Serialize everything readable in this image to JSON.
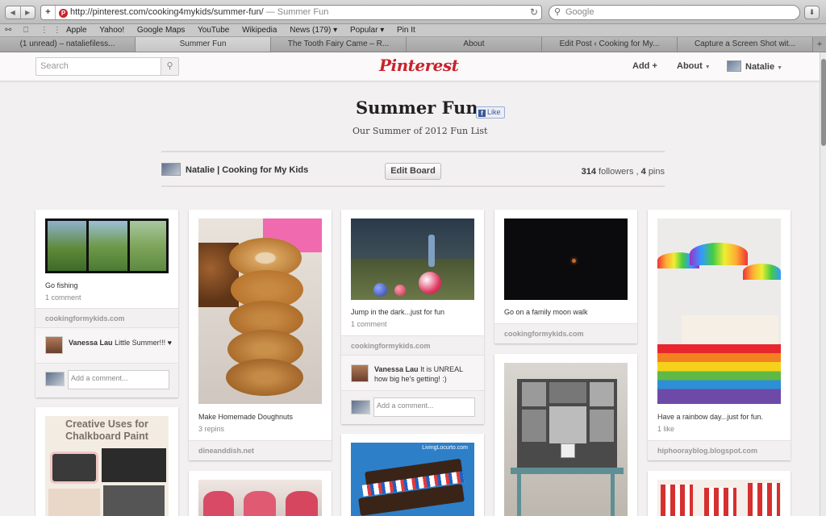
{
  "browser": {
    "url": "http://pinterest.com/cooking4mykids/summer-fun/",
    "page_title": "— Summer Fun",
    "search_placeholder": "Google",
    "bookmarks": [
      "Apple",
      "Yahoo!",
      "Google Maps",
      "YouTube",
      "Wikipedia",
      "News (179) ▾",
      "Popular ▾",
      "Pin It"
    ],
    "tabs": [
      {
        "label": "(1 unread) – nataliefiless...",
        "active": false
      },
      {
        "label": "Summer Fun",
        "active": true
      },
      {
        "label": "The Tooth Fairy Came – R...",
        "active": false
      },
      {
        "label": "About",
        "active": false
      },
      {
        "label": "Edit Post ‹ Cooking for My...",
        "active": false
      },
      {
        "label": "Capture a Screen Shot wit...",
        "active": false
      }
    ]
  },
  "header": {
    "search_placeholder": "Search",
    "logo": "Pinterest",
    "add": "Add",
    "about": "About",
    "user": "Natalie"
  },
  "board": {
    "title": "Summer Fun",
    "like": "Like",
    "description": "Our Summer of 2012 Fun List",
    "owner": "Natalie | Cooking for My Kids",
    "edit_button": "Edit Board",
    "followers_count": "314",
    "followers_label": "followers",
    "pins_count": "4",
    "pins_label": "pins"
  },
  "pins": {
    "fishing": {
      "description": "Go fishing",
      "meta": "1 comment",
      "source": "cookingformykids.com",
      "commenter": "Vanessa Lau",
      "comment": "Little Summer!!! ♥",
      "add_comment": "Add a comment..."
    },
    "chalkboard": {
      "image_caption": "Creative Uses for Chalkboard Paint"
    },
    "doughnuts": {
      "description": "Make Homemade Doughnuts",
      "meta": "3 repins",
      "source": "dineanddish.net"
    },
    "jump": {
      "description": "Jump in the dark...just for fun",
      "meta": "1 comment",
      "source": "cookingformykids.com",
      "commenter": "Vanessa Lau",
      "comment": "It is UNREAL how big he's getting! :)",
      "add_comment": "Add a comment..."
    },
    "icecream": {
      "watermark": "LivingLocurto.com"
    },
    "moon": {
      "description": "Go on a family moon walk",
      "source": "cookingformykids.com"
    },
    "rainbow": {
      "description": "Have a rainbow day...just for fun.",
      "meta": "1 like",
      "source": "hiphoorayblog.blogspot.com"
    }
  },
  "colors": {
    "brand": "#c8232c",
    "page_bg": "#f2f0f0"
  }
}
